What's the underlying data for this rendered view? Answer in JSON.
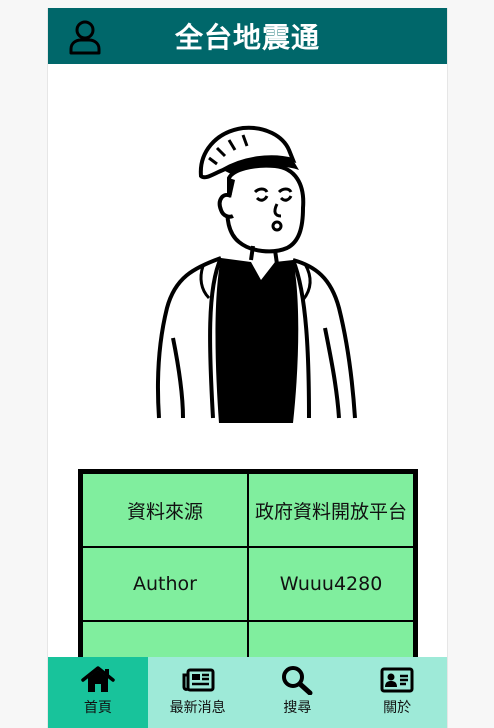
{
  "header": {
    "title": "全台地震通",
    "user_icon": "user-icon"
  },
  "info_table": {
    "rows": [
      {
        "label": "資料來源",
        "value": "政府資料開放平台"
      },
      {
        "label": "Author",
        "value": "Wuuu4280"
      },
      {
        "label": "",
        "value": ""
      }
    ]
  },
  "tabbar": {
    "active": "home",
    "items": [
      {
        "id": "home",
        "label": "首頁",
        "icon": "home-icon"
      },
      {
        "id": "news",
        "label": "最新消息",
        "icon": "newspaper-icon"
      },
      {
        "id": "search",
        "label": "搜尋",
        "icon": "search-icon"
      },
      {
        "id": "about",
        "label": "關於",
        "icon": "id-card-icon"
      }
    ]
  },
  "colors": {
    "header_bg": "#00676a",
    "table_cell_bg": "#80ee9e",
    "tabbar_bg": "#9eead8",
    "tab_active_bg": "#18c39b"
  }
}
